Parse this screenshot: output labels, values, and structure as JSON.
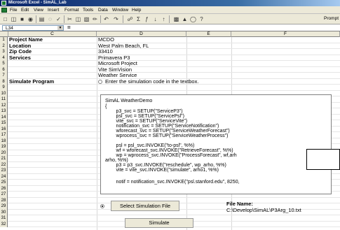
{
  "window": {
    "title": "Microsoft Excel - SimAL_Lab"
  },
  "menubar": {
    "items": [
      "File",
      "Edit",
      "View",
      "Insert",
      "Format",
      "Tools",
      "Data",
      "Window",
      "Help"
    ]
  },
  "toolbar": {
    "prompt_label": "Prompt"
  },
  "formula_bar": {
    "cell_ref": "L34",
    "equals": "="
  },
  "columns": [
    "C",
    "D",
    "E",
    "F"
  ],
  "rows": {
    "numbers": [
      "1",
      "2",
      "3",
      "4",
      "5",
      "6",
      "7",
      "8",
      "9",
      "10",
      "11",
      "12",
      "13",
      "14",
      "15",
      "16",
      "17",
      "18",
      "19",
      "20",
      "21",
      "22",
      "23",
      "24",
      "25",
      "26",
      "27",
      "28",
      "29",
      "30",
      "31",
      "32"
    ],
    "project_name_label": "Project Name",
    "project_name_value": "MCDO",
    "location_label": "Location",
    "location_value": "West Palm Beach, FL",
    "zip_label": "Zip Code",
    "zip_value": "33410",
    "services_label": "Services",
    "services": [
      "Primavera P3",
      "Microsoft Project",
      "Vite SimVision",
      "Weather Service"
    ],
    "simulate_label": "Simulate Program",
    "simulate_option": "Enter the simulation code in the textbox."
  },
  "code": {
    "lines": [
      "SimAL WeatherDemo",
      "{",
      "        p3_svc = SETUP(\"ServiceP3\")",
      "        psl_svc = SETUP(\"ServicePsl\")",
      "        vite_svc = SETUP(\"ServiceVite\")",
      "        notification_svc = SETUP(\"ServiceNotification\")",
      "        wforecast_svc = SETUP(\"ServiceWeatherForecast\")",
      "        wprocess_svc = SETUP(\"ServiceWeatherProcess\")",
      "",
      "        psl = psl_svc.INVOKE(\"to-psl\", %%)",
      "        wf = wforecast_svc.INVOKE(\"RetrieveForecast\", %%)",
      "        wp = wprocess_svc.INVOKE(\"ProcessForecast\", wf,arh",
      "arho, %%)",
      "        p3 = p3_svc.INVOKE(\"reschedule\", wp_arho, %%)",
      "        vite = vite_svc.INVOKE(\"simulate\", arho1, %%)",
      "",
      "        notif = notification_svc.INVOKE(\"psl.stanford.edu\", 8250,"
    ]
  },
  "file_section": {
    "select_button": "Select Simulation File",
    "file_name_label": "File Name:",
    "file_path": "C:\\Develop\\SimAL\\P3Arg_10.txt"
  },
  "simulate_button": "Simulate"
}
